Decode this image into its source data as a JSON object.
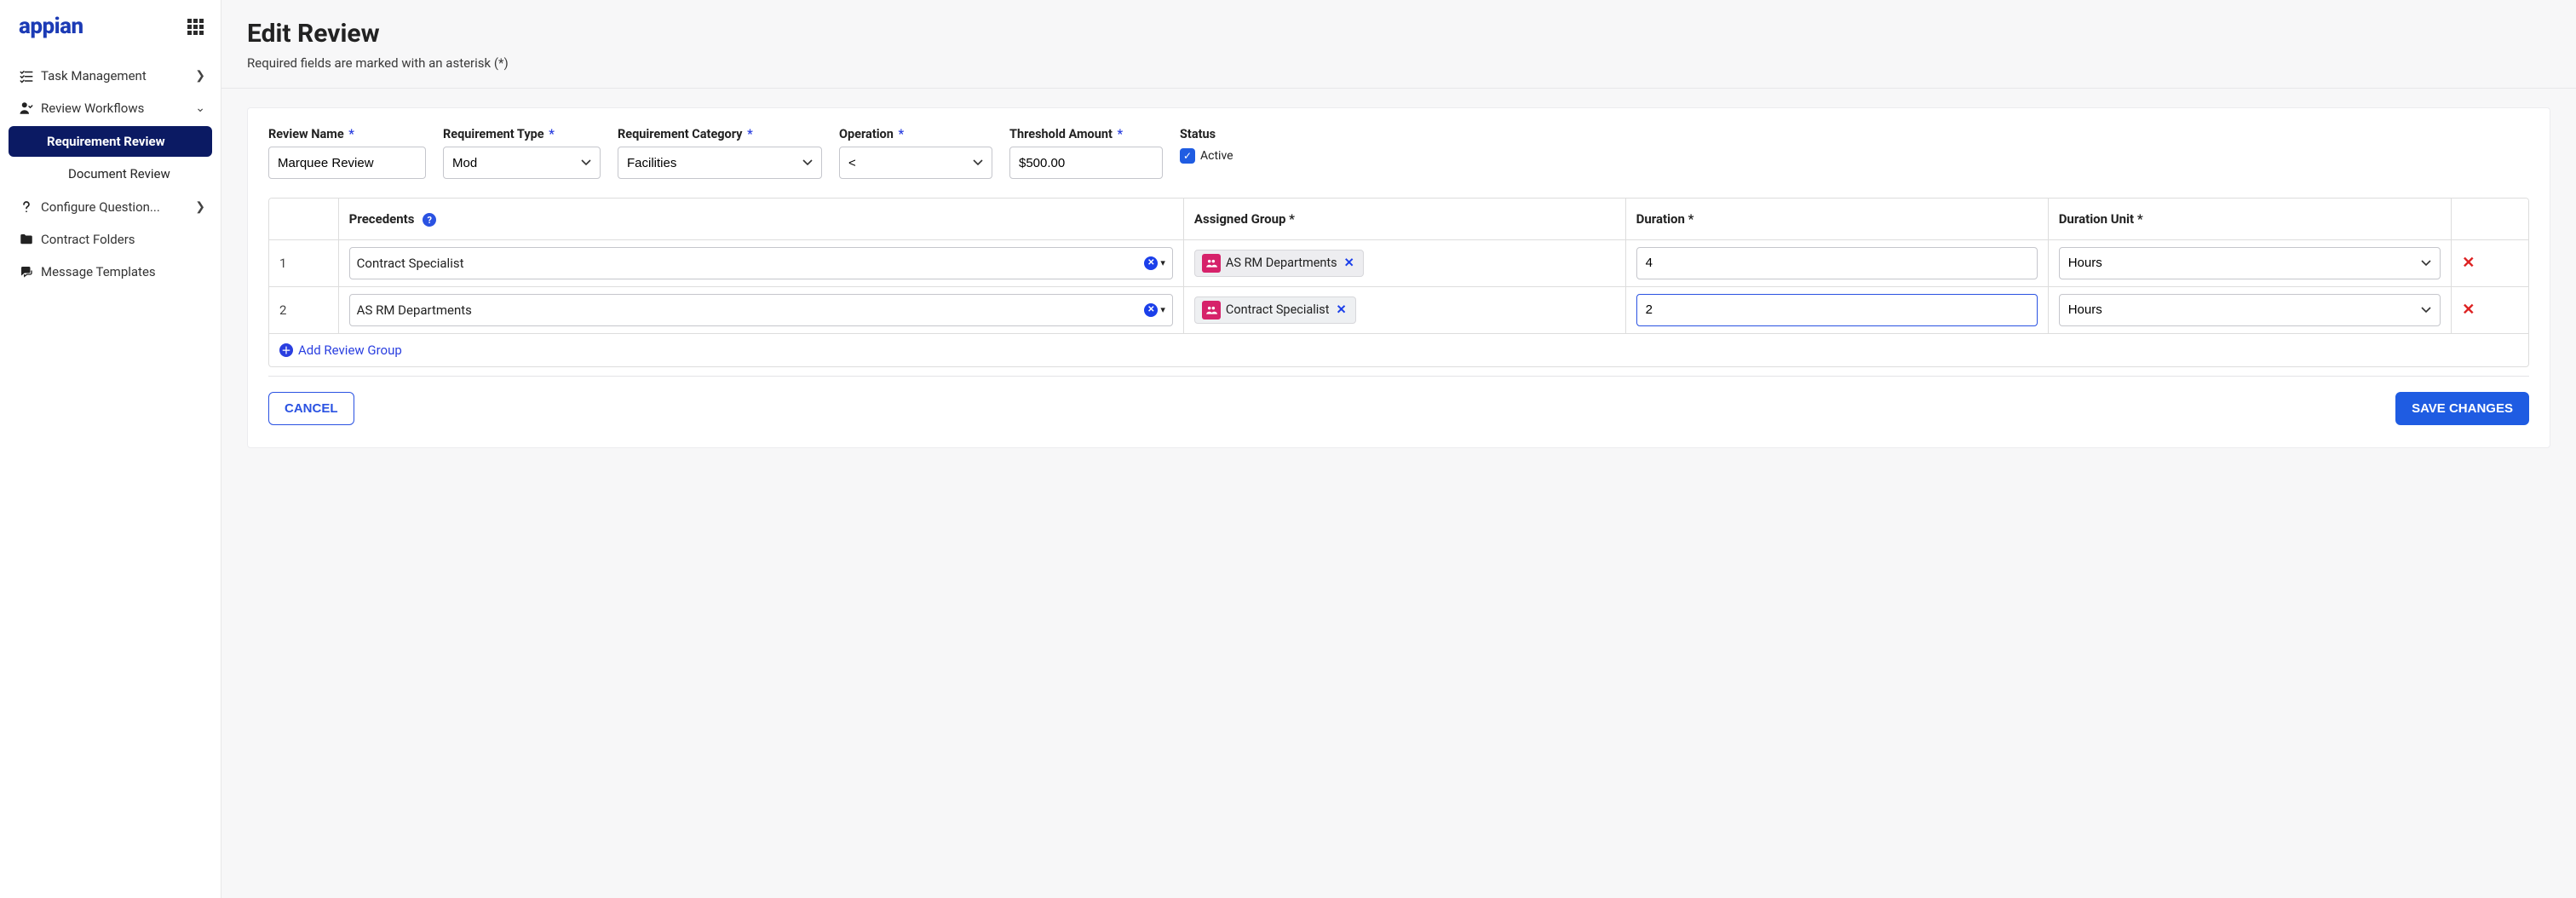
{
  "brand": {
    "logo": "appian"
  },
  "sidebar": {
    "items": [
      {
        "label": "Task Management",
        "chevron": "right"
      },
      {
        "label": "Review Workflows",
        "chevron": "down"
      },
      {
        "label": "Configure Question...",
        "chevron": "right"
      },
      {
        "label": "Contract Folders"
      },
      {
        "label": "Message Templates"
      }
    ],
    "sub": {
      "requirement_review": "Requirement Review",
      "document_review": "Document Review"
    }
  },
  "page": {
    "title": "Edit Review",
    "subtitle": "Required fields are marked with an asterisk (*)"
  },
  "fields": {
    "review_name": {
      "label": "Review Name",
      "value": "Marquee Review"
    },
    "requirement_type": {
      "label": "Requirement Type",
      "value": "Mod"
    },
    "requirement_category": {
      "label": "Requirement Category",
      "value": "Facilities"
    },
    "operation": {
      "label": "Operation",
      "value": "<"
    },
    "threshold": {
      "label": "Threshold Amount",
      "value": "$500.00"
    },
    "status": {
      "label": "Status",
      "checkbox_label": "Active"
    }
  },
  "table": {
    "headers": {
      "precedents": "Precedents",
      "assigned_group": "Assigned Group *",
      "duration": "Duration *",
      "duration_unit": "Duration Unit *"
    },
    "rows": [
      {
        "index": "1",
        "precedent": "Contract Specialist",
        "group": "AS RM Departments",
        "duration": "4",
        "unit": "Hours"
      },
      {
        "index": "2",
        "precedent": "AS RM Departments",
        "group": "Contract Specialist",
        "duration": "2",
        "unit": "Hours"
      }
    ],
    "add_link": "Add Review Group"
  },
  "buttons": {
    "cancel": "CANCEL",
    "save": "SAVE CHANGES"
  }
}
